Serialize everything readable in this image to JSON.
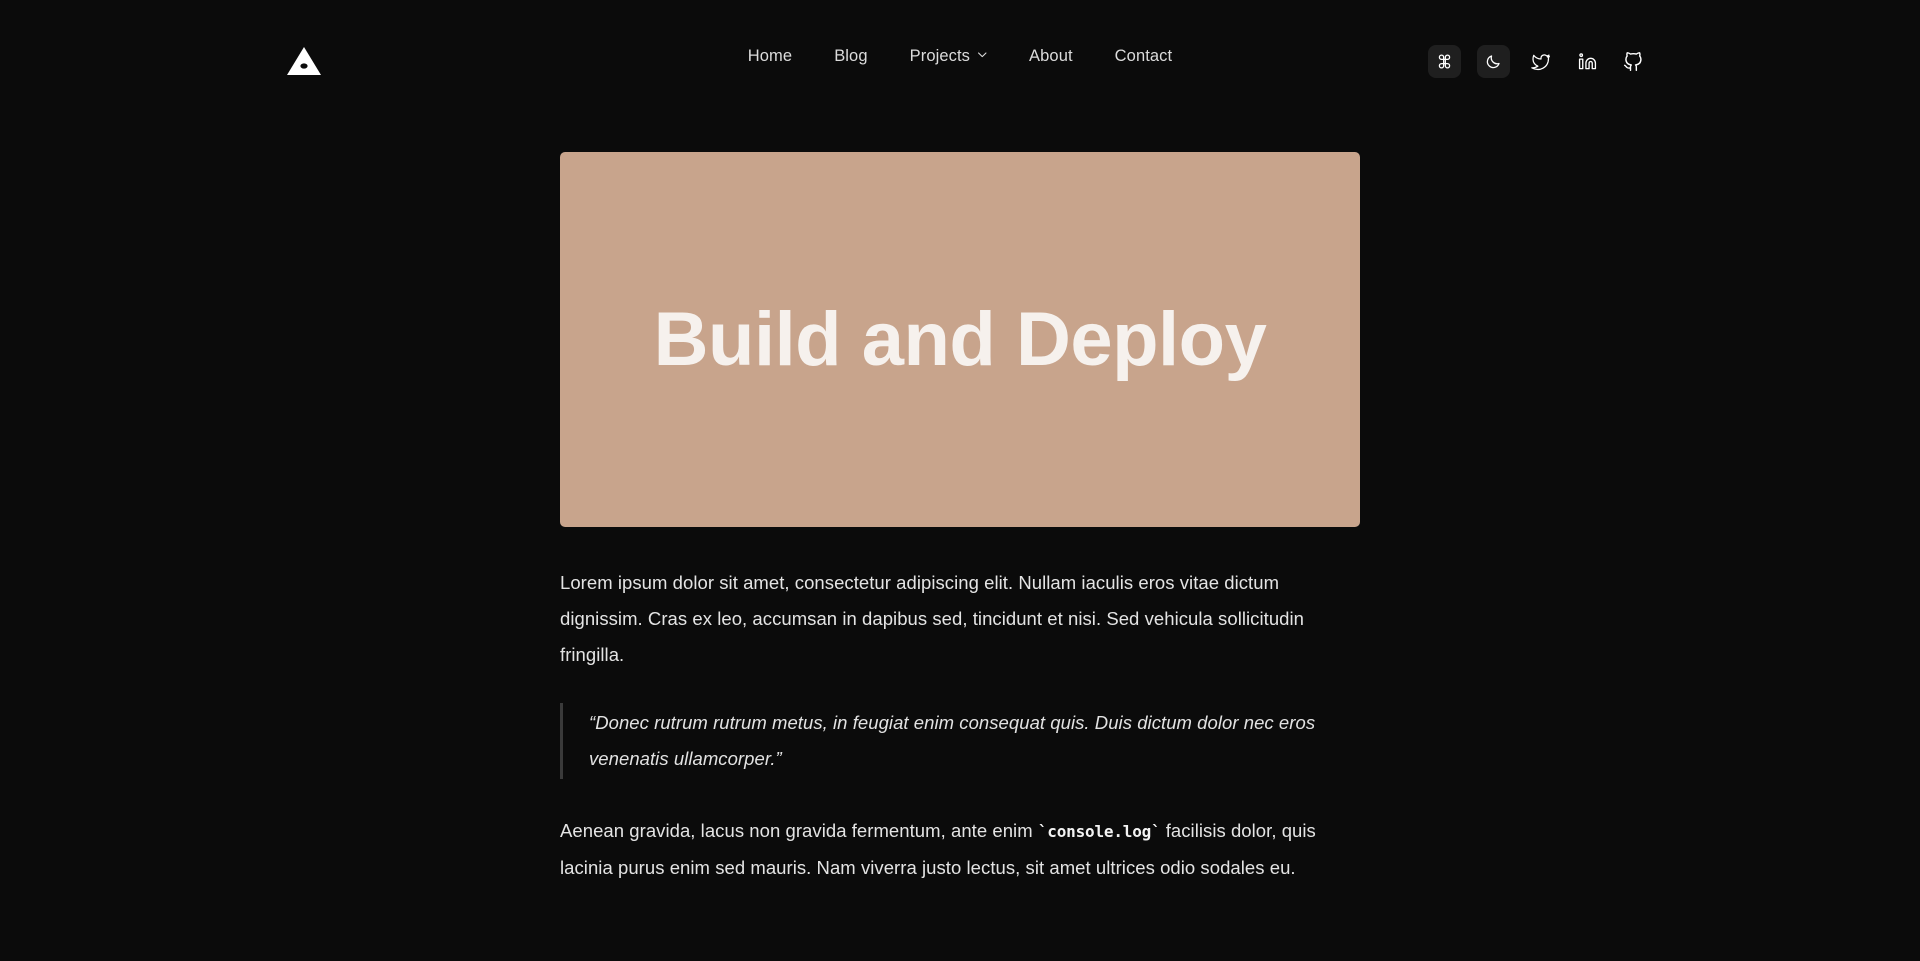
{
  "theme": {
    "page_background": "#0b0b0b",
    "banner_background": "#c8a48c",
    "banner_text_color": "#f6f1ed",
    "body_text_color": "#e4e4e4",
    "icon_box_background": "#1f1f1f",
    "quote_border_color": "#3a3a3a"
  },
  "header": {
    "logo_name": "triangle-logo",
    "nav": [
      {
        "label": "Home",
        "has_dropdown": false
      },
      {
        "label": "Blog",
        "has_dropdown": false
      },
      {
        "label": "Projects",
        "has_dropdown": true
      },
      {
        "label": "About",
        "has_dropdown": false
      },
      {
        "label": "Contact",
        "has_dropdown": false
      }
    ],
    "tools": [
      {
        "name": "command-palette-button",
        "icon": "command-icon",
        "boxed": true
      },
      {
        "name": "theme-toggle-button",
        "icon": "moon-icon",
        "boxed": true
      },
      {
        "name": "twitter-link",
        "icon": "twitter-icon",
        "boxed": false
      },
      {
        "name": "linkedin-link",
        "icon": "linkedin-icon",
        "boxed": false
      },
      {
        "name": "github-link",
        "icon": "github-icon",
        "boxed": false
      }
    ]
  },
  "article": {
    "hero": {
      "title": "Build and Deploy"
    },
    "paragraph_1": "Lorem ipsum dolor sit amet, consectetur adipiscing elit. Nullam iaculis eros vitae dictum dignissim. Cras ex leo, accumsan in dapibus sed, tincidunt et nisi. Sed vehicula sollicitudin fringilla.",
    "blockquote": "“Donec rutrum rutrum metus, in feugiat enim consequat quis. Duis dictum dolor nec eros venenatis ullamcorper.”",
    "paragraph_2": {
      "before_code": "Aenean gravida, lacus non gravida fermentum, ante enim ",
      "code": "`console.log`",
      "after_code": " facilisis dolor, quis lacinia purus enim sed mauris. Nam viverra justo lectus, sit amet ultrices odio sodales eu."
    }
  }
}
